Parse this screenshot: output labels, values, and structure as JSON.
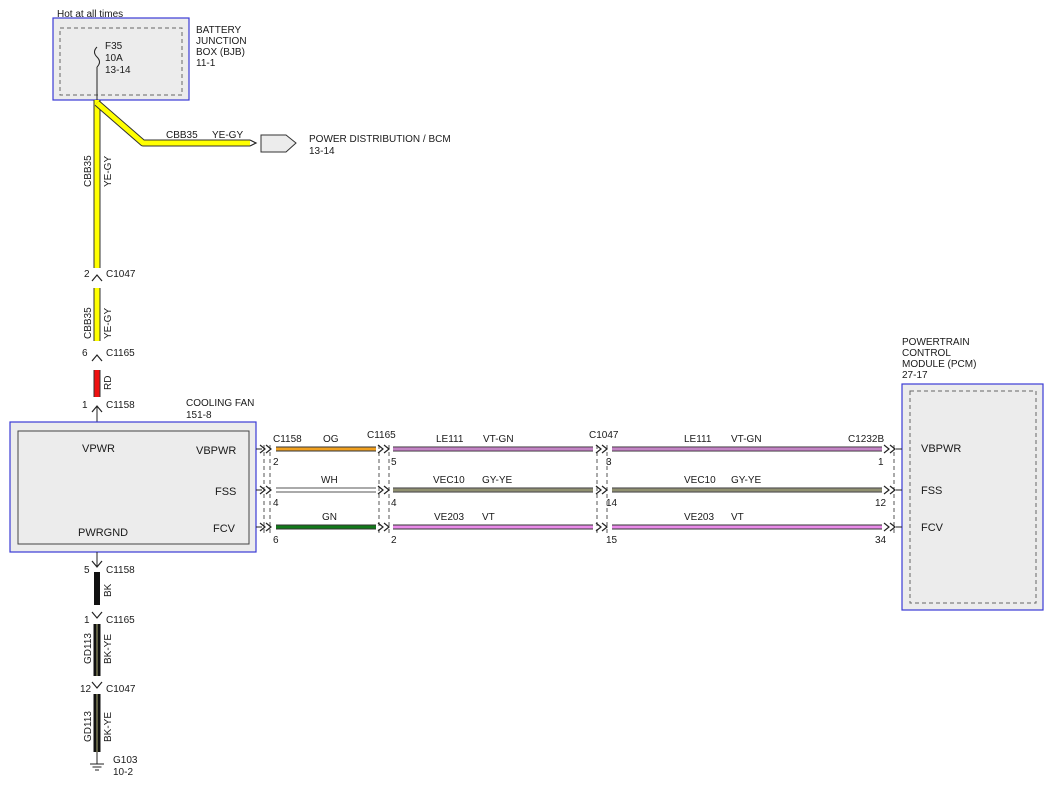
{
  "colors": {
    "box_border": "#3b3bd6",
    "box_fill": "#ececec",
    "yellow": "#ffff00",
    "red": "#ee1111",
    "black": "#111111",
    "orange": "#f0a020",
    "white_wire": "#ffffff",
    "green": "#11791a",
    "violet": "#e98be9",
    "violet_green": "#9b7fa0",
    "gray_yellow": "#7a7a55"
  },
  "bjb": {
    "hot_label": "Hot at all times",
    "title": [
      "BATTERY",
      "JUNCTION",
      "BOX (BJB)",
      "11-1"
    ],
    "fuse": [
      "F35",
      "10A",
      "13-14"
    ]
  },
  "power_dist": {
    "circuit": "CBB35",
    "color": "YE-GY",
    "label": "POWER DISTRIBUTION / BCM",
    "ref": "13-14"
  },
  "vertical_top": {
    "seg1_circuit": "CBB35",
    "seg1_color": "YE-GY",
    "c1047_pin": "2",
    "c1047": "C1047",
    "seg2_circuit": "CBB35",
    "seg2_color": "YE-GY",
    "c1165_pin": "6",
    "c1165": "C1165",
    "seg3_color": "RD",
    "c1158_pin": "1",
    "c1158": "C1158"
  },
  "fan": {
    "title": "COOLING FAN",
    "ref": "151-8",
    "vpwr": "VPWR",
    "pwrgnd": "PWRGND",
    "vbpwr": "VBPWR",
    "fss": "FSS",
    "fcv": "FCV"
  },
  "pcm": {
    "title": [
      "POWERTRAIN",
      "CONTROL",
      "MODULE (PCM)",
      "27-17"
    ],
    "vbpwr": "VBPWR",
    "fss": "FSS",
    "fcv": "FCV"
  },
  "wires": {
    "row1": {
      "c1158": "C1158",
      "c1158_pin": "2",
      "color1": "OG",
      "c1165": "C1165",
      "c1165_pin": "5",
      "circ2": "LE111",
      "color2": "VT-GN",
      "c1047": "C1047",
      "c1047_pin": "3",
      "circ3": "LE111",
      "color3": "VT-GN",
      "c1232": "C1232B",
      "c1232_pin": "1"
    },
    "row2": {
      "pin1": "4",
      "color1": "WH",
      "pin2": "4",
      "circ2": "VEC10",
      "color2": "GY-YE",
      "pin3": "14",
      "circ3": "VEC10",
      "color3": "GY-YE",
      "pin4": "12"
    },
    "row3": {
      "pin1": "6",
      "color1": "GN",
      "pin2": "2",
      "circ2": "VE203",
      "color2": "VT",
      "pin3": "15",
      "circ3": "VE203",
      "color3": "VT",
      "pin4": "34"
    }
  },
  "ground": {
    "c1158_pin": "5",
    "c1158": "C1158",
    "seg1_color": "BK",
    "c1165_pin": "1",
    "c1165": "C1165",
    "seg2_circuit": "GD113",
    "seg2_color": "BK-YE",
    "c1047_pin": "12",
    "c1047": "C1047",
    "seg3_circuit": "GD113",
    "seg3_color": "BK-YE",
    "g": "G103",
    "g_ref": "10-2"
  }
}
